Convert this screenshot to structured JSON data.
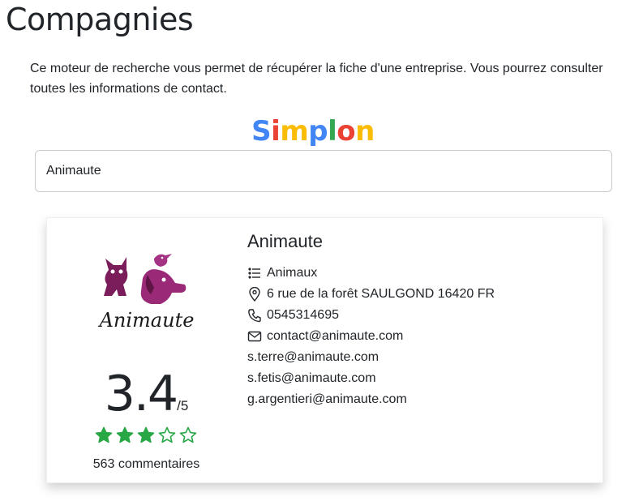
{
  "page": {
    "title": "Compagnies",
    "intro": "Ce moteur de recherche vous permet de récupérer la fiche d'une entreprise. Vous pourrez consulter toutes les informations de contact."
  },
  "logo": {
    "letters": [
      {
        "char": "S",
        "color": "#4285f4"
      },
      {
        "char": "i",
        "color": "#ea4335"
      },
      {
        "char": "m",
        "color": "#fbbc05"
      },
      {
        "char": "p",
        "color": "#4285f4"
      },
      {
        "char": "l",
        "color": "#34a853"
      },
      {
        "char": "o",
        "color": "#ea4335"
      },
      {
        "char": "n",
        "color": "#fbbc05"
      }
    ]
  },
  "search": {
    "value": "Animaute"
  },
  "company": {
    "name": "Animaute",
    "logo_text": "Animaute",
    "category": "Animaux",
    "address": "6 rue de la forêt SAULGOND 16420 FR",
    "phone": "0545314695",
    "email": "contact@animaute.com",
    "extra_emails": [
      "s.terre@animaute.com",
      "s.fetis@animaute.com",
      "g.argentieri@animaute.com"
    ],
    "rating": "3.4",
    "rating_scale": "/5",
    "stars": 3,
    "max_stars": 5,
    "star_color": "#28a745",
    "reviews": "563 commentaires",
    "icons": [
      "list-icon",
      "map-pin-icon",
      "phone-icon",
      "envelope-icon"
    ]
  }
}
